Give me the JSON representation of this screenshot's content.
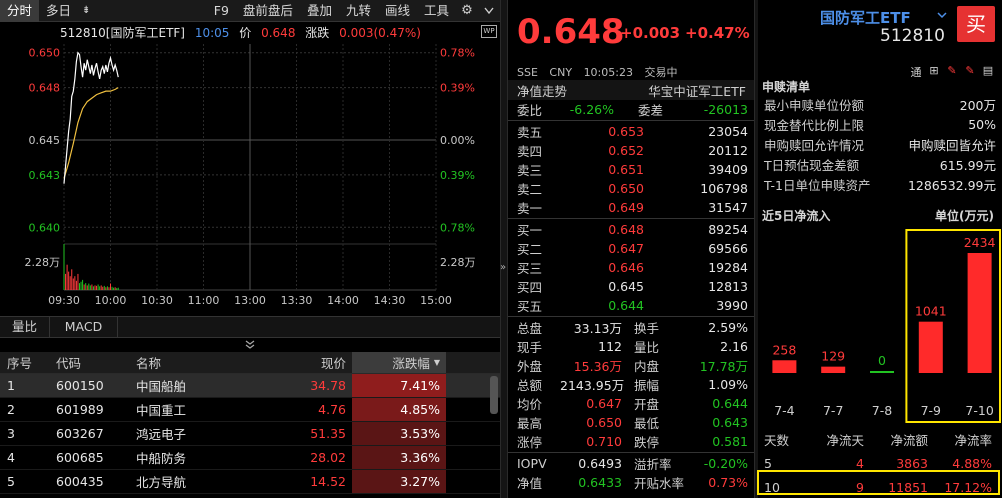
{
  "toolbar": {
    "tabs": [
      "分时",
      "多日",
      "F9",
      "盘前盘后",
      "叠加",
      "九转",
      "画线",
      "工具"
    ],
    "dropdown_glyph": "⇟",
    "gear": "⚙"
  },
  "chart_header": {
    "code_name": "512810[国防军工ETF]",
    "time": "10:05",
    "price_label": "价",
    "price": "0.648",
    "chg_label": "涨跌",
    "chg": "0.003(0.47%)"
  },
  "price_axis": {
    "left_labels": [
      "0.650",
      "0.648",
      "0.645",
      "0.643",
      "0.640"
    ],
    "right_labels": [
      "0.78%",
      "0.39%",
      "0.00%",
      "0.39%",
      "0.78%"
    ],
    "volume_label": "2.28万",
    "time_labels": [
      "09:30",
      "10:00",
      "10:30",
      "11:00",
      "13:00",
      "13:30",
      "14:00",
      "14:30",
      "15:00"
    ]
  },
  "chart_data": {
    "type": "line",
    "title": "",
    "x_unit": "minutes since 09:30",
    "ylim": [
      0.6395,
      0.6505
    ],
    "price_series": [
      [
        0,
        0.6425
      ],
      [
        1,
        0.6435
      ],
      [
        2,
        0.6445
      ],
      [
        3,
        0.6455
      ],
      [
        4,
        0.6462
      ],
      [
        5,
        0.6475
      ],
      [
        6,
        0.6478
      ],
      [
        7,
        0.6485
      ],
      [
        8,
        0.6495
      ],
      [
        9,
        0.65
      ],
      [
        10,
        0.6499
      ],
      [
        11,
        0.6492
      ],
      [
        12,
        0.6486
      ],
      [
        13,
        0.6494
      ],
      [
        14,
        0.649
      ],
      [
        15,
        0.6496
      ],
      [
        16,
        0.6492
      ],
      [
        17,
        0.6488
      ],
      [
        18,
        0.6493
      ],
      [
        19,
        0.6487
      ],
      [
        20,
        0.6491
      ],
      [
        21,
        0.6494
      ],
      [
        22,
        0.6489
      ],
      [
        23,
        0.6485
      ],
      [
        24,
        0.649
      ],
      [
        25,
        0.6492
      ],
      [
        26,
        0.6488
      ],
      [
        27,
        0.6493
      ],
      [
        28,
        0.6489
      ],
      [
        29,
        0.6494
      ],
      [
        30,
        0.6497
      ],
      [
        31,
        0.6493
      ],
      [
        32,
        0.649
      ],
      [
        33,
        0.6493
      ],
      [
        34,
        0.649
      ],
      [
        35,
        0.6486
      ]
    ],
    "avg_series": [
      [
        0,
        0.6428
      ],
      [
        3,
        0.6437
      ],
      [
        6,
        0.6448
      ],
      [
        9,
        0.646
      ],
      [
        12,
        0.6468
      ],
      [
        15,
        0.6472
      ],
      [
        18,
        0.6474
      ],
      [
        21,
        0.6476
      ],
      [
        24,
        0.6477
      ],
      [
        27,
        0.6478
      ],
      [
        30,
        0.6478
      ],
      [
        33,
        0.6479
      ],
      [
        35,
        0.648
      ]
    ],
    "volume_series": [
      [
        0,
        1.0
      ],
      [
        1,
        0.35
      ],
      [
        2,
        0.55
      ],
      [
        3,
        0.4
      ],
      [
        4,
        0.3
      ],
      [
        5,
        0.45
      ],
      [
        6,
        0.25
      ],
      [
        7,
        0.3
      ],
      [
        8,
        0.2
      ],
      [
        9,
        0.35
      ],
      [
        10,
        0.15
      ],
      [
        11,
        0.18
      ],
      [
        12,
        0.22
      ],
      [
        13,
        0.12
      ],
      [
        14,
        0.15
      ],
      [
        15,
        0.1
      ],
      [
        16,
        0.14
      ],
      [
        17,
        0.1
      ],
      [
        18,
        0.12
      ],
      [
        19,
        0.08
      ],
      [
        20,
        0.1
      ],
      [
        21,
        0.09
      ],
      [
        22,
        0.12
      ],
      [
        23,
        0.08
      ],
      [
        24,
        0.1
      ],
      [
        25,
        0.07
      ],
      [
        26,
        0.09
      ],
      [
        27,
        0.06
      ],
      [
        28,
        0.08
      ],
      [
        29,
        0.06
      ],
      [
        30,
        0.14
      ],
      [
        31,
        0.07
      ],
      [
        32,
        0.05
      ],
      [
        33,
        0.06
      ],
      [
        34,
        0.04
      ],
      [
        35,
        0.05
      ]
    ],
    "volume_max": 2.28
  },
  "indicator_tabs": [
    "量比",
    "MACD"
  ],
  "stock_table": {
    "headers": [
      "序号",
      "代码",
      "名称",
      "现价",
      "涨跌幅"
    ],
    "sort_glyph": "▼",
    "rows": [
      {
        "idx": "1",
        "code": "600150",
        "name": "中国船舶",
        "price": "34.78",
        "pct": "7.41%"
      },
      {
        "idx": "2",
        "code": "601989",
        "name": "中国重工",
        "price": "4.76",
        "pct": "4.85%"
      },
      {
        "idx": "3",
        "code": "603267",
        "name": "鸿远电子",
        "price": "51.35",
        "pct": "3.53%"
      },
      {
        "idx": "4",
        "code": "600685",
        "name": "中船防务",
        "price": "28.02",
        "pct": "3.36%"
      },
      {
        "idx": "5",
        "code": "600435",
        "name": "北方导航",
        "price": "14.52",
        "pct": "3.27%"
      }
    ]
  },
  "quote": {
    "price": "0.648",
    "chg": "+0.003",
    "pct": "+0.47%",
    "exchange": "SSE",
    "currency": "CNY",
    "time": "10:05:23",
    "status": "交易中"
  },
  "orderbook": {
    "nav_label": "净值走势",
    "fund_name": "华宝中证军工ETF",
    "weibi_label": "委比",
    "weibi": "-6.26%",
    "weicha_label": "委差",
    "weicha": "-26013",
    "asks": [
      {
        "label": "卖五",
        "price": "0.653",
        "vol": "23054"
      },
      {
        "label": "卖四",
        "price": "0.652",
        "vol": "20112"
      },
      {
        "label": "卖三",
        "price": "0.651",
        "vol": "39409"
      },
      {
        "label": "卖二",
        "price": "0.650",
        "vol": "106798"
      },
      {
        "label": "卖一",
        "price": "0.649",
        "vol": "31547"
      }
    ],
    "bids": [
      {
        "label": "买一",
        "price": "0.648",
        "vol": "89254"
      },
      {
        "label": "买二",
        "price": "0.647",
        "vol": "69566"
      },
      {
        "label": "买三",
        "price": "0.646",
        "vol": "19284"
      },
      {
        "label": "买四",
        "price": "0.645",
        "vol": "12813"
      },
      {
        "label": "买五",
        "price": "0.644",
        "vol": "3990"
      }
    ]
  },
  "stats": [
    {
      "a": "总盘",
      "b": "33.13万",
      "c": "换手",
      "d": "2.59%",
      "bc": "white",
      "dc": "white"
    },
    {
      "a": "现手",
      "b": "112",
      "c": "量比",
      "d": "2.16",
      "bc": "white",
      "dc": "white"
    },
    {
      "a": "外盘",
      "b": "15.36万",
      "c": "内盘",
      "d": "17.78万",
      "bc": "red",
      "dc": "green"
    },
    {
      "a": "总额",
      "b": "2143.95万",
      "c": "振幅",
      "d": "1.09%",
      "bc": "white",
      "dc": "white"
    },
    {
      "a": "均价",
      "b": "0.647",
      "c": "开盘",
      "d": "0.644",
      "bc": "red",
      "dc": "green"
    },
    {
      "a": "最高",
      "b": "0.650",
      "c": "最低",
      "d": "0.643",
      "bc": "red",
      "dc": "green"
    },
    {
      "a": "涨停",
      "b": "0.710",
      "c": "跌停",
      "d": "0.581",
      "bc": "red",
      "dc": "green"
    }
  ],
  "iopv": [
    {
      "a": "IOPV",
      "b": "0.6493",
      "c": "溢折率",
      "d": "-0.20%",
      "bc": "white",
      "dc": "green"
    },
    {
      "a": "净值",
      "b": "0.6433",
      "c": "开贴水率",
      "d": "0.73%",
      "bc": "green",
      "dc": "red"
    }
  ],
  "etf": {
    "name": "国防军工ETF",
    "code": "512810",
    "buy": "买"
  },
  "right_icons": [
    "通",
    "⊞",
    "✎",
    "✎",
    "▤"
  ],
  "sub_list": {
    "title": "申赎清单",
    "rows": [
      {
        "k": "最小申赎单位份额",
        "v": "200万"
      },
      {
        "k": "现金替代比例上限",
        "v": "50%"
      },
      {
        "k": "申购赎回允许情况",
        "v": "申购赎回皆允许"
      },
      {
        "k": "T日预估现金差额",
        "v": "615.99元"
      },
      {
        "k": "T-1日单位申赎资产",
        "v": "1286532.99元"
      }
    ]
  },
  "flow": {
    "title": "近5日净流入",
    "unit": "单位(万元)",
    "chart_data": {
      "type": "bar",
      "categories": [
        "7-4",
        "7-7",
        "7-8",
        "7-9",
        "7-10"
      ],
      "values": [
        258,
        129,
        0,
        1041,
        2434
      ],
      "ylim": [
        0,
        2434
      ]
    }
  },
  "flow_table": {
    "headers": [
      "天数",
      "净流天",
      "净流额",
      "净流率"
    ],
    "rows": [
      {
        "days": "5",
        "cnt": "4",
        "amt": "3863",
        "rate": "4.88%"
      },
      {
        "days": "10",
        "cnt": "9",
        "amt": "11851",
        "rate": "17.12%"
      }
    ]
  }
}
